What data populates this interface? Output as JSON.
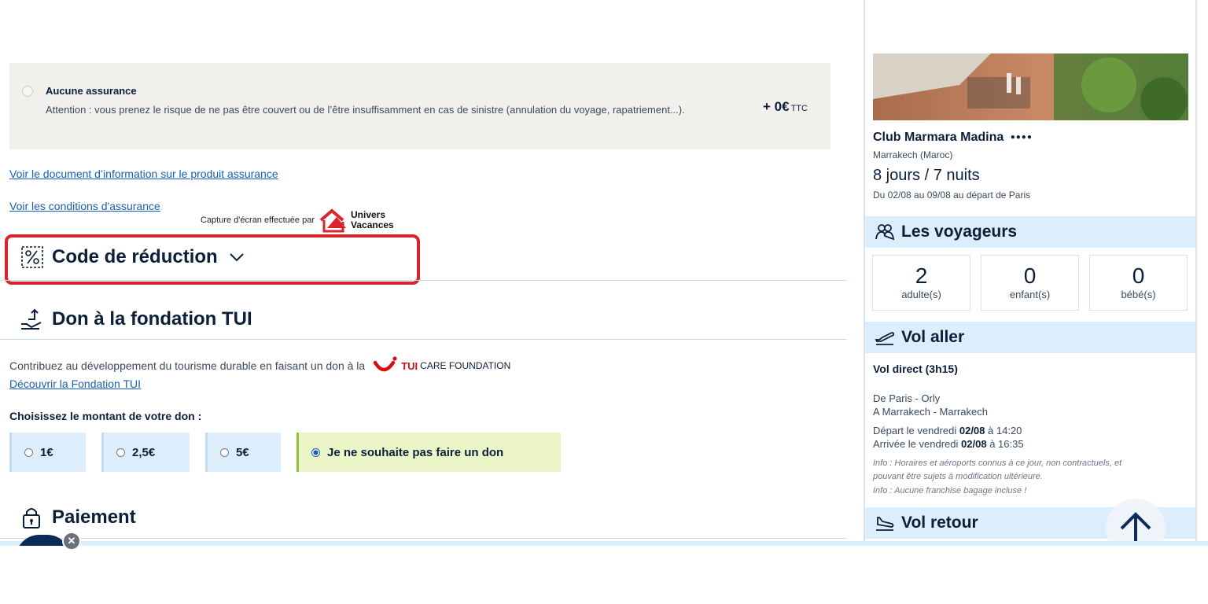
{
  "insurance": {
    "none_title": "Aucune assurance",
    "none_desc": "Attention : vous prenez le risque de ne pas être couvert ou de l’être insuffisamment en cas de sinistre (annulation du voyage, rapatriement...).",
    "none_price": "+ 0€",
    "none_price_suffix": "TTC",
    "link_doc": "Voir le document d’information sur le produit assurance",
    "link_conditions": "Voir les conditions d'assurance"
  },
  "watermark": {
    "text": "Capture d'écran effectuée par",
    "brand_line1": "Univers",
    "brand_line2": "Vacances"
  },
  "reduction": {
    "title": "Code de réduction"
  },
  "donation": {
    "title": "Don à la fondation TUI",
    "text": "Contribuez au développement du tourisme durable en faisant un don à la",
    "logo_tui": "TUI",
    "logo_rest": "CARE FOUNDATION",
    "link": "Découvrir la Fondation TUI",
    "choose_label": "Choisissez le montant de votre don :",
    "options": [
      {
        "label": "1€",
        "selected": false
      },
      {
        "label": "2,5€",
        "selected": false
      },
      {
        "label": "5€",
        "selected": false
      },
      {
        "label": "Je ne souhaite pas faire un don",
        "selected": true
      }
    ]
  },
  "payment": {
    "title": "Paiement"
  },
  "summary": {
    "hotel_name": "Club Marmara Madina",
    "location": "Marrakech (Maroc)",
    "duration": "8 jours / 7 nuits",
    "dates": "Du 02/08 au 09/08 au départ de Paris",
    "travelers_title": "Les voyageurs",
    "travelers": [
      {
        "count": "2",
        "label": "adulte(s)"
      },
      {
        "count": "0",
        "label": "enfant(s)"
      },
      {
        "count": "0",
        "label": "bébé(s)"
      }
    ],
    "outbound_title": "Vol aller",
    "outbound_type": "Vol direct (3h15)",
    "from": "De Paris - Orly",
    "to": "A Marrakech - Marrakech",
    "depart_prefix": "Départ le vendredi",
    "depart_date": "02/08",
    "depart_time": "à 14:20",
    "arrive_prefix": "Arrivée le vendredi",
    "arrive_date": "02/08",
    "arrive_time": "à 16:35",
    "info1": "Info : Horaires et aéroports connus à ce jour, non contractuels, et",
    "info2": "pouvant être sujets à modification ultérieure.",
    "info3": "Info : Aucune franchise bagage incluse !",
    "return_title": "Vol retour"
  },
  "colors": {
    "accent": "#1a5fb4",
    "highlight_red": "#d9242b",
    "tui_red": "#d40e14",
    "light_blue": "#dceefb",
    "selected_green": "#ebf5c8"
  }
}
